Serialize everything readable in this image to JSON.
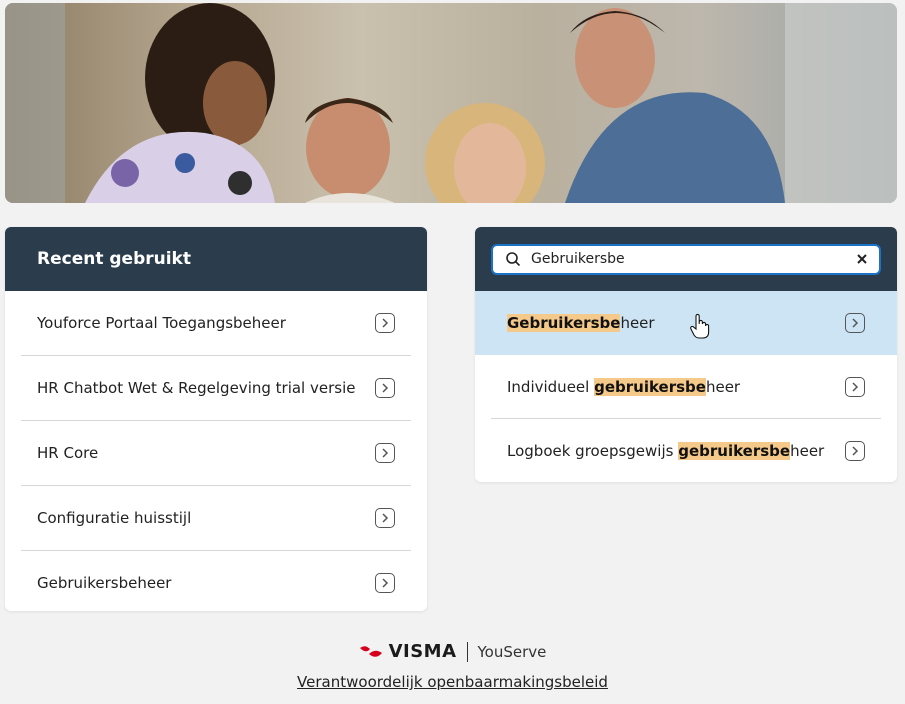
{
  "recent": {
    "title": "Recent gebruikt",
    "items": [
      "Youforce Portaal Toegangsbeheer",
      "HR Chatbot Wet & Regelgeving trial versie",
      "HR Core",
      "Configuratie huisstijl",
      "Gebruikersbeheer"
    ]
  },
  "search": {
    "value": "Gebruikersbe",
    "results": [
      {
        "before": "",
        "match": "Gebruikersbe",
        "after": "heer"
      },
      {
        "before": "Individueel ",
        "match": "gebruikersbe",
        "after": "heer"
      },
      {
        "before": "Logboek groepsgewijs ",
        "match": "gebruikersbe",
        "after": "heer"
      }
    ]
  },
  "footer": {
    "brand": "VISMA",
    "product": "YouServe",
    "policy_link": "Verantwoordelijk openbaarmakingsbeleid"
  },
  "colors": {
    "header_bg": "#2b3d4d",
    "highlight": "#f5c98a",
    "active_row": "#cde4f5",
    "focus_border": "#1a73c8",
    "brand_red": "#d6001c"
  }
}
